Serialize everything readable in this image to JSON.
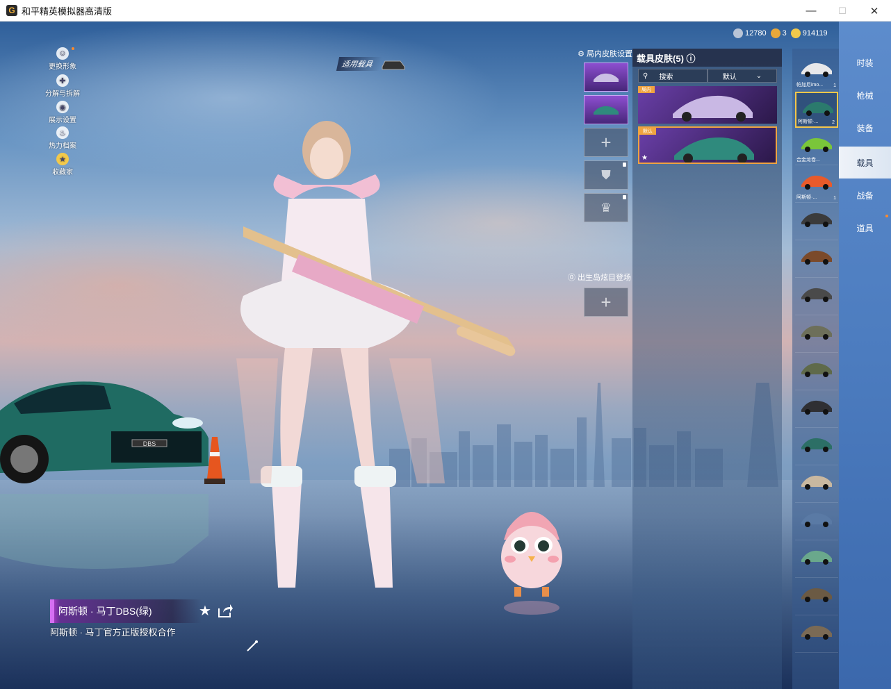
{
  "window": {
    "title": "和平精英模拟器高清版",
    "minimize": "—",
    "maximize": "☐",
    "close": "✕"
  },
  "currency": [
    {
      "value": "12780",
      "color": "#b9c4d6"
    },
    {
      "value": "3",
      "color": "#e8a83a"
    },
    {
      "value": "914119",
      "color": "#f2c94c"
    }
  ],
  "side_menu": [
    "更换形象",
    "分解与拆解",
    "展示设置",
    "热力档案",
    "收藏家"
  ],
  "usage_tag": "适用载具",
  "slots_heading": "局内皮肤设置",
  "spawn_heading": "出生岛炫目登场",
  "panel": {
    "title": "载具皮肤",
    "count": "(5)",
    "search_label": "搜索",
    "sort_label": "默认",
    "cards": [
      {
        "tag": "局内",
        "color": "#c9b8e4"
      },
      {
        "tag": "默认",
        "color": "#2f8a7d"
      }
    ]
  },
  "tabs": [
    "时装",
    "枪械",
    "装备",
    "载具",
    "战备",
    "道具"
  ],
  "active_tab": "载具",
  "vehicles": [
    {
      "name": "帕加尼imo...",
      "count": "1",
      "color": "#e8e8ea"
    },
    {
      "name": "阿斯顿·...",
      "count": "2",
      "color": "#2b7a6d"
    },
    {
      "name": "合金龙卷...",
      "count": "",
      "color": "#7ac63a"
    },
    {
      "name": "阿斯顿·...",
      "count": "1",
      "color": "#e85a2a"
    },
    {
      "name": "",
      "count": "",
      "color": "#3b3b3b"
    },
    {
      "name": "",
      "count": "",
      "color": "#7b4a2a"
    },
    {
      "name": "",
      "count": "",
      "color": "#4a4a4a"
    },
    {
      "name": "",
      "count": "",
      "color": "#6d6f5a"
    },
    {
      "name": "",
      "count": "",
      "color": "#5f6a4a"
    },
    {
      "name": "",
      "count": "",
      "color": "#2f2f33"
    },
    {
      "name": "",
      "count": "",
      "color": "#2c6f66"
    },
    {
      "name": "",
      "count": "",
      "color": "#c9b8a0"
    },
    {
      "name": "",
      "count": "",
      "color": "#5a7aa5"
    },
    {
      "name": "",
      "count": "",
      "color": "#6aa88c"
    },
    {
      "name": "",
      "count": "",
      "color": "#6b5a44"
    },
    {
      "name": "",
      "count": "",
      "color": "#7a6a55"
    }
  ],
  "skin_name": "阿斯顿 · 马丁DBS(绿)",
  "description": "阿斯顿 · 马丁官方正版授权合作",
  "car_plate": "DBS",
  "accent_color": "#d56ff2"
}
